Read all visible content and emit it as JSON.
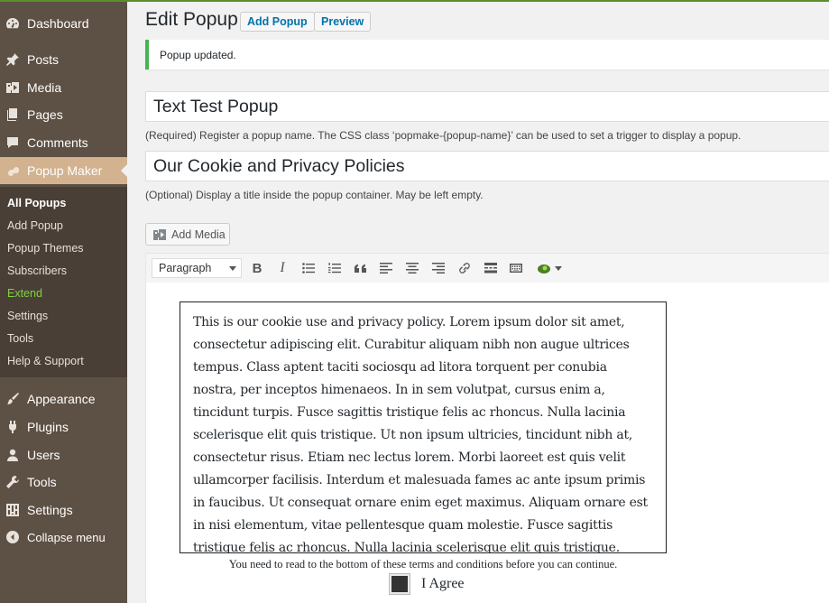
{
  "sidebar": {
    "items_top": [
      {
        "label": "Dashboard",
        "icon": "dashboard-icon"
      },
      {
        "label": "Posts",
        "icon": "pin-icon"
      },
      {
        "label": "Media",
        "icon": "media-icon"
      },
      {
        "label": "Pages",
        "icon": "pages-icon"
      },
      {
        "label": "Comments",
        "icon": "comment-icon"
      },
      {
        "label": "Popup Maker",
        "icon": "popup-maker-icon"
      }
    ],
    "submenu": [
      "All Popups",
      "Add Popup",
      "Popup Themes",
      "Subscribers",
      "Extend",
      "Settings",
      "Tools",
      "Help & Support"
    ],
    "items_bottom": [
      {
        "label": "Appearance",
        "icon": "paint-brush-icon"
      },
      {
        "label": "Plugins",
        "icon": "plugin-icon"
      },
      {
        "label": "Users",
        "icon": "user-icon"
      },
      {
        "label": "Tools",
        "icon": "wrench-icon"
      },
      {
        "label": "Settings",
        "icon": "settings-sliders-icon"
      },
      {
        "label": "Collapse menu",
        "icon": "collapse-arrow-icon"
      }
    ]
  },
  "header": {
    "title": "Edit Popup",
    "add_popup": "Add Popup",
    "preview": "Preview"
  },
  "notice": "Popup updated.",
  "popup_name": {
    "value": "Text Test Popup",
    "help": "(Required) Register a popup name. The CSS class ‘popmake-{popup-name}’ can be used to set a trigger to display a popup."
  },
  "popup_title": {
    "value": "Our Cookie and Privacy Policies",
    "help": "(Optional) Display a title inside the popup container. May be left empty."
  },
  "editor": {
    "add_media": "Add Media",
    "format": "Paragraph",
    "bold": "B",
    "italic": "I",
    "policy_text": "This is our cookie use and privacy policy. Lorem ipsum dolor sit amet, consectetur adipiscing elit. Curabitur aliquam nibh non augue ultrices tempus. Class aptent taciti sociosqu ad litora torquent per conubia nostra, per inceptos himenaeos. In in sem volutpat, cursus enim a, tincidunt turpis. Fusce sagittis tristique felis ac rhoncus. Nulla lacinia scelerisque elit quis tristique. Ut non ipsum ultricies, tincidunt nibh at, consectetur risus. Etiam nec lectus lorem. Morbi laoreet est quis velit ullamcorper facilisis. Interdum et malesuada fames ac ante ipsum primis in faucibus. Ut consequat ornare enim eget maximus. Aliquam ornare est in nisi elementum, vitae pellentesque quam molestie. Fusce sagittis tristique felis ac rhoncus. Nulla lacinia scelerisque elit quis tristique.",
    "footnote": "You need to read to the bottom of these terms and conditions before you can continue.",
    "agree_label": "I Agree"
  },
  "colors": {
    "sidebar": "#5d5044",
    "submenu": "#4a3f36",
    "current_item": "#d2b28f",
    "extend_link": "#7cd43e",
    "notice_border": "#46b450",
    "link": "#0073aa"
  }
}
